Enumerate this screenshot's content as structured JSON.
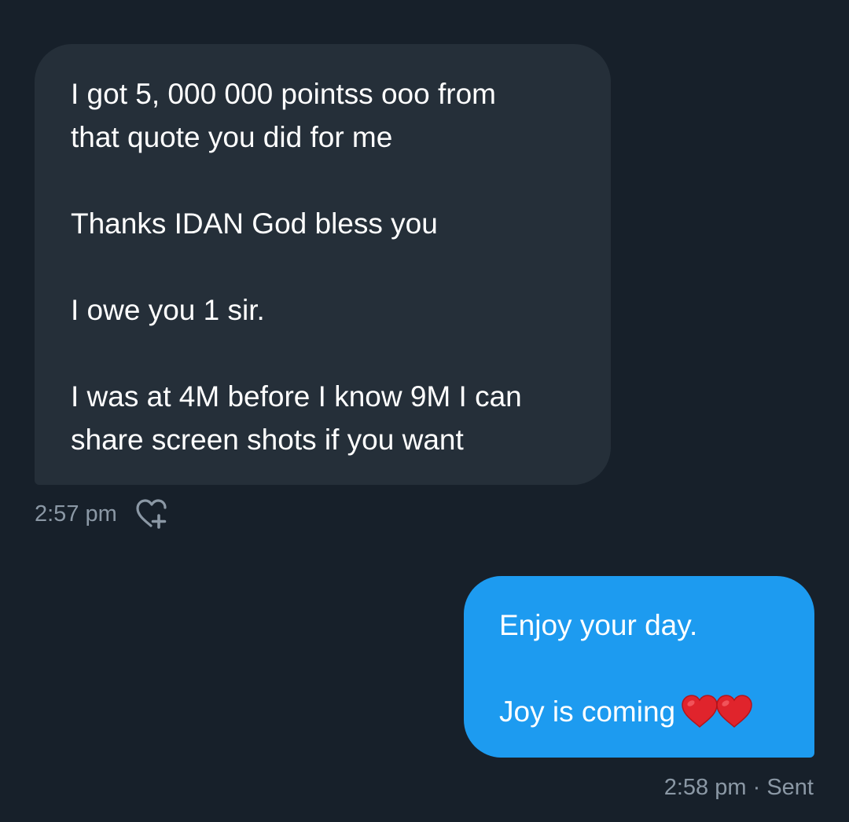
{
  "conversation": {
    "received_message": {
      "paragraphs": [
        "I got 5, 000 000 pointss ooo from\nthat quote you did for me",
        "Thanks IDAN God bless you",
        "I owe you 1 sir.",
        "I was at 4M before I know 9M I can\nshare screen shots if you want"
      ],
      "time": "2:57 pm",
      "react_icon": "heart-plus-icon"
    },
    "sent_message": {
      "paragraphs": [
        "Enjoy your day.",
        "Joy is coming"
      ],
      "emoji": "❤️❤️",
      "time": "2:58 pm",
      "separator": "·",
      "status": "Sent"
    }
  },
  "colors": {
    "background": "#17202a",
    "received_bubble": "#252f39",
    "sent_bubble": "#1d9bf0",
    "meta_text": "#8b98a5",
    "heart": "#e0242c"
  }
}
